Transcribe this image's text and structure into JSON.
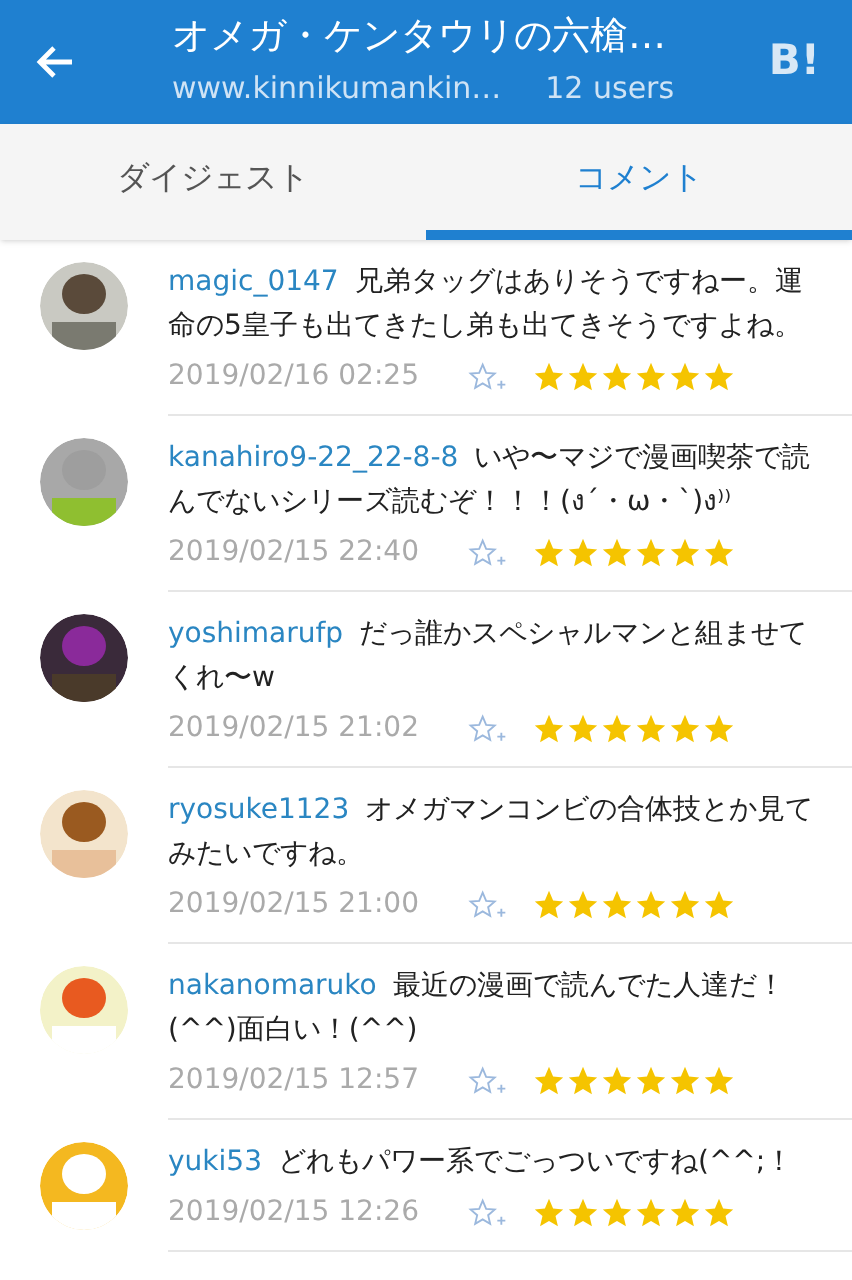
{
  "header": {
    "title": "オメガ・ケンタウリの六槍…",
    "url": "www.kinnikumankin…",
    "users": "12 users",
    "badge": "B!"
  },
  "tabs": [
    {
      "label": "ダイジェスト",
      "selected": false
    },
    {
      "label": "コメント",
      "selected": true
    }
  ],
  "comments": [
    {
      "user": "magic_0147",
      "text": "兄弟タッグはありそうですねー。運命の5皇子も出てきたし弟も出てきそうですよね。",
      "date": "2019/02/16 02:25",
      "stars": 6
    },
    {
      "user": "kanahiro9-22_22-8-8",
      "text": "いや〜マジで漫画喫茶で読んでないシリーズ読むぞ！！！(ง´・ω・`)ง⁾⁾",
      "date": "2019/02/15 22:40",
      "stars": 6
    },
    {
      "user": "yoshimarufp",
      "text": "だっ誰かスペシャルマンと組ませてくれ〜w",
      "date": "2019/02/15 21:02",
      "stars": 6
    },
    {
      "user": "ryosuke1123",
      "text": "オメガマンコンビの合体技とか見てみたいですね。",
      "date": "2019/02/15 21:00",
      "stars": 6
    },
    {
      "user": "nakanomaruko",
      "text": "最近の漫画で読んでた人達だ！(^^)面白い！(^^)",
      "date": "2019/02/15 12:57",
      "stars": 6
    },
    {
      "user": "yuki53",
      "text": "どれもパワー系でごっついですね(^^;！",
      "date": "2019/02/15 12:26",
      "stars": 6
    }
  ]
}
